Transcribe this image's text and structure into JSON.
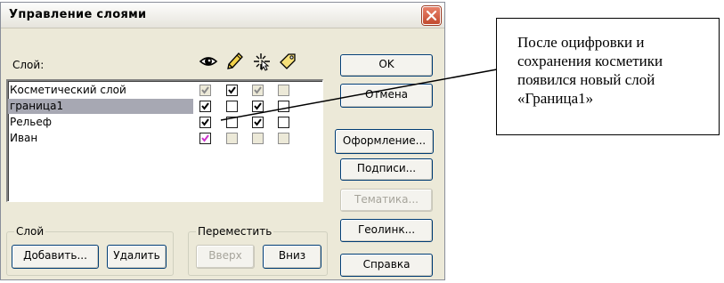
{
  "dialog": {
    "title": "Управление слоями",
    "list_label": "Слой:",
    "column_icons": [
      "eye-icon",
      "pencil-icon",
      "cursor-icon",
      "tag-icon"
    ],
    "layers": [
      {
        "name": "Косметический слой",
        "selected": false,
        "checks": [
          {
            "checked": true,
            "disabled": true
          },
          {
            "checked": true,
            "disabled": false
          },
          {
            "checked": true,
            "disabled": true
          },
          {
            "checked": false,
            "disabled": true
          }
        ]
      },
      {
        "name": "граница1",
        "selected": true,
        "checks": [
          {
            "checked": true,
            "disabled": false
          },
          {
            "checked": false,
            "disabled": false
          },
          {
            "checked": true,
            "disabled": false
          },
          {
            "checked": false,
            "disabled": false
          }
        ]
      },
      {
        "name": "Рельеф",
        "selected": false,
        "checks": [
          {
            "checked": true,
            "disabled": false
          },
          {
            "checked": false,
            "disabled": false
          },
          {
            "checked": true,
            "disabled": false
          },
          {
            "checked": false,
            "disabled": false
          }
        ]
      },
      {
        "name": "Иван",
        "selected": false,
        "checks": [
          {
            "checked": true,
            "disabled": false,
            "color": "#cc33cc"
          },
          {
            "checked": false,
            "disabled": true
          },
          {
            "checked": false,
            "disabled": true
          },
          {
            "checked": false,
            "disabled": true
          }
        ]
      }
    ],
    "buttons": {
      "ok": "OK",
      "cancel": "Отмена",
      "design": "Оформление...",
      "labels": "Подписи...",
      "thematic": "Тематика...",
      "geolink": "Геолинк...",
      "help": "Справка"
    },
    "group_layer": {
      "title": "Слой",
      "add": "Добавить...",
      "delete": "Удалить"
    },
    "group_move": {
      "title": "Переместить",
      "up": "Вверх",
      "down": "Вниз"
    }
  },
  "callout": {
    "text": "После оцифровки и сохранения косметики появился новый слой «Граница1»"
  },
  "colors": {
    "dialog_bg": "#ece9d8",
    "selection": "#a7a8b3",
    "close_button": "#c24a2f",
    "check_magenta": "#cc33cc"
  }
}
